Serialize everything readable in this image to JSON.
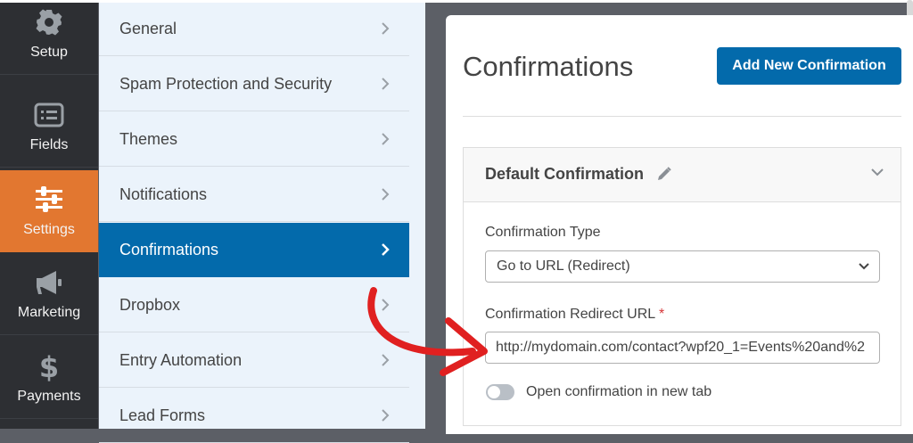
{
  "leftbar": {
    "items": [
      {
        "label": "Setup",
        "icon": "gear-icon"
      },
      {
        "label": "Fields",
        "icon": "list-icon"
      },
      {
        "label": "Settings",
        "icon": "sliders-icon",
        "active": true
      },
      {
        "label": "Marketing",
        "icon": "megaphone-icon"
      },
      {
        "label": "Payments",
        "icon": "dollar-icon"
      }
    ]
  },
  "subnav": {
    "items": [
      {
        "label": "General"
      },
      {
        "label": "Spam Protection and Security"
      },
      {
        "label": "Themes"
      },
      {
        "label": "Notifications"
      },
      {
        "label": "Confirmations",
        "active": true
      },
      {
        "label": "Dropbox"
      },
      {
        "label": "Entry Automation"
      },
      {
        "label": "Lead Forms"
      }
    ]
  },
  "main": {
    "title": "Confirmations",
    "add_button": "Add New Confirmation",
    "card": {
      "title": "Default Confirmation",
      "type_label": "Confirmation Type",
      "type_value": "Go to URL (Redirect)",
      "url_label": "Confirmation Redirect URL",
      "required_mark": "*",
      "url_value": "http://mydomain.com/contact?wpf20_1=Events%20and%2",
      "toggle_label": "Open confirmation in new tab",
      "toggle_on": false
    }
  },
  "colors": {
    "accent_orange": "#e27730",
    "accent_blue": "#036aab",
    "annotation_red": "#e02020"
  }
}
